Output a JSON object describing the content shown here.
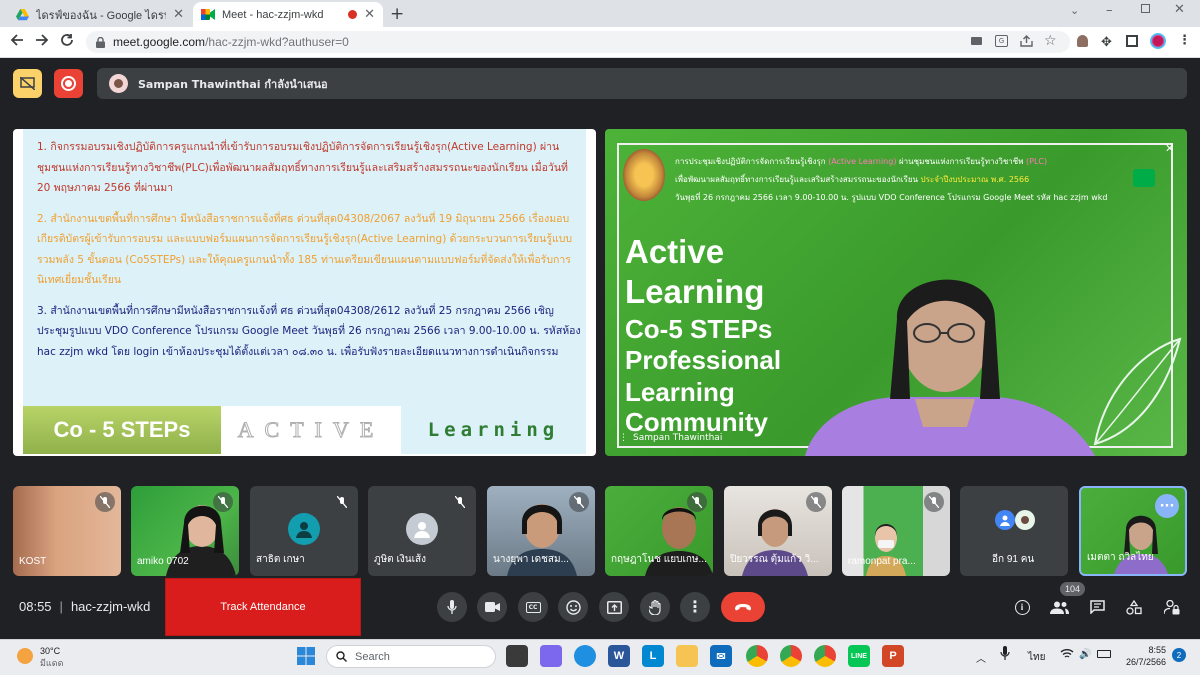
{
  "browser": {
    "tabs": [
      {
        "title": "ไดรฟ์ของฉัน - Google ไดรฟ์"
      },
      {
        "title": "Meet - hac-zzjm-wkd"
      }
    ],
    "url_host": "meet.google.com",
    "url_path": "/hac-zzjm-wkd?authuser=0"
  },
  "meet": {
    "presenter_banner": "Sampan Thawinthai กำลังนำเสนอ",
    "meeting_code": "hac-zzjm-wkd",
    "time": "08:55",
    "track_attendance": "Track Attendance",
    "participant_count": "104",
    "record_color": "#ea4335",
    "end_call_color": "#ea4335"
  },
  "slide": {
    "para1": "1.  กิจกรรมอบรมเชิงปฏิบัติการครูแกนนำที่เข้ารับการอบรมเชิงปฏิบัติการจัดการเรียนรู้เชิงรุก(Active Learning) ผ่านชุมชนแห่งการเรียนรู้ทางวิชาชีพ(PLC)เพื่อพัฒนาผลสัมฤทธิ์ทางการเรียนรู้และเสริมสร้างสมรรถนะของนักเรียน เมื่อวันที่ 20 พฤษภาคม 2566 ที่ผ่านมา",
    "para2": "2. สำนักงานเขตพื้นที่การศึกษา มีหนังสือราชการแจ้งที่ศธ ด่วนที่สุด04308/2067 ลงวันที่ 19 มิถุนายน 2566 เรื่องมอบเกียรติบัตรผู้เข้ารับการอบรม และแบบฟอร์มแผนการจัดการเรียนรู้เชิงรุก(Active Learning) ด้วยกระบวนการเรียนรู้แบบรวมพลัง 5 ขั้นตอน (Co5STEPs)  และให้คุณครูแกนนำทั้ง 185 ท่านเตรียมเขียนแผนตามแบบฟอร์มที่จัดส่งให้เพื่อรับการนิเทศเยี่ยมชั้นเรียน",
    "para3": "3. สำนักงานเขตพื้นที่การศึกษามีหนังสือราชการแจ้งที่ ศธ ด่วนที่สุด04308/2612 ลงวันที่ 25 กรกฎาคม 2566  เชิญประชุมรูปแบบ VDO Conference โปรแกรม Google Meet วันพุธที่ 26 กรกฎาคม 2566 เวลา 9.00-10.00 น. รหัสห้อง hac zzjm wkd  โดย login เข้าห้องประชุมได้ตั้งแต่เวลา ๐๘.๓๐ น. เพื่อรับฟังรายละเอียดแนวทางการดำเนินกิจกรรม",
    "footer_left": "Co - 5 STEPs",
    "footer_mid": "ACTIVE",
    "footer_right": "Learning"
  },
  "camera": {
    "header_line1_a": "การประชุมเชิงปฏิบัติการจัดการเรียนรู้เชิงรุก ",
    "header_line1_b": "(Active Learning)",
    "header_line1_c": " ผ่านชุมชนแห่งการเรียนรู้ทางวิชาชีพ ",
    "header_line1_d": "(PLC)",
    "header_line2_a": "เพื่อพัฒนาผลสัมฤทธิ์ทางการเรียนรู้และเสริมสร้างสมรรถนะของนักเรียน ",
    "header_line2_b": "ประจำปีงบประมาณ พ.ศ. 2566",
    "header_line3": "วันพุธที่ 26 กรกฎาคม 2566 เวลา 9.00-10.00 น. รูปแบบ VDO Conference โปรแกรม Google Meet รหัส hac zzjm wkd",
    "big1": "Active",
    "big2": "Learning",
    "big3": "Co-5 STEPs",
    "big4": "Professional",
    "big5": "Learning",
    "big6": "Community",
    "name": "Sampan Thawinthai"
  },
  "participants": [
    {
      "name": "KOST"
    },
    {
      "name": "amiko 0702"
    },
    {
      "name": "สาธิต เกษา"
    },
    {
      "name": "ภูษิต เงินเส้ง"
    },
    {
      "name": "นางยุพา เดชสม..."
    },
    {
      "name": "กฤษฎาโนช แยบเกษ..."
    },
    {
      "name": "ปิยวรรณ ตุ้มแก้ว วิ..."
    },
    {
      "name": "ramonpat pra..."
    },
    {
      "name": "อีก 91 คน"
    },
    {
      "name": "เมตตา ถวิลไทย"
    }
  ],
  "taskbar": {
    "temperature": "30°C",
    "weather": "มีแดด",
    "search": "Search",
    "lang": "ไทย",
    "clock_time": "8:55",
    "clock_date": "26/7/2566",
    "notif_count": "2"
  }
}
